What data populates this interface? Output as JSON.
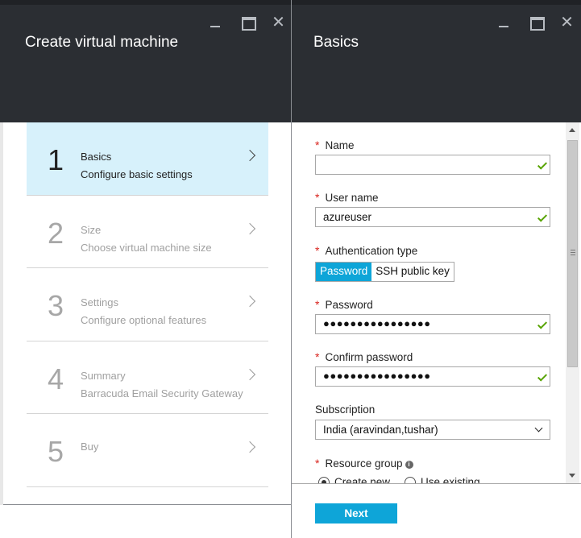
{
  "left_blade": {
    "title": "Create virtual machine",
    "steps": [
      {
        "number": "1",
        "title": "Basics",
        "subtitle": "Configure basic settings",
        "active": true
      },
      {
        "number": "2",
        "title": "Size",
        "subtitle": "Choose virtual machine size",
        "active": false
      },
      {
        "number": "3",
        "title": "Settings",
        "subtitle": "Configure optional features",
        "active": false
      },
      {
        "number": "4",
        "title": "Summary",
        "subtitle": "Barracuda Email Security Gateway",
        "active": false
      },
      {
        "number": "5",
        "title": "Buy",
        "subtitle": "",
        "active": false
      }
    ]
  },
  "right_blade": {
    "title": "Basics",
    "required_marker": "*",
    "fields": {
      "name": {
        "label": "Name",
        "value": ""
      },
      "user_name": {
        "label": "User name",
        "value": "azureuser"
      },
      "auth_type": {
        "label": "Authentication type",
        "options": [
          "Password",
          "SSH public key"
        ],
        "selected": "Password"
      },
      "password": {
        "label": "Password",
        "value": "●●●●●●●●●●●●●●●●"
      },
      "confirm_password": {
        "label": "Confirm password",
        "value": "●●●●●●●●●●●●●●●●"
      },
      "subscription": {
        "label": "Subscription",
        "value": "India (aravindan,tushar)"
      },
      "resource_group": {
        "label": "Resource group",
        "options": [
          "Create new",
          "Use existing"
        ],
        "selected": "Create new"
      }
    },
    "next_label": "Next"
  },
  "colors": {
    "header_bg": "#2b2e33",
    "active_step_bg": "#d7f1fb",
    "accent": "#0ea5d8",
    "required": "#d9231d",
    "valid_check": "#57a300"
  },
  "icons": [
    "minimize-icon",
    "maximize-icon",
    "close-icon",
    "chevron-right-icon",
    "checkmark-icon",
    "chevron-down-icon",
    "info-icon"
  ]
}
